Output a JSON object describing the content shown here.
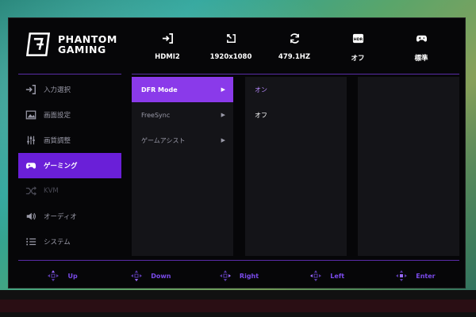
{
  "brand": {
    "line1": "PHANTOM",
    "line2": "GAMING"
  },
  "status": [
    {
      "icon": "input-icon",
      "value": "HDMI2"
    },
    {
      "icon": "resolution-icon",
      "value": "1920x1080"
    },
    {
      "icon": "refresh-icon",
      "value": "479.1HZ"
    },
    {
      "icon": "hdr-icon",
      "value": "オフ",
      "badge": "HDR"
    },
    {
      "icon": "gamepad-icon",
      "value": "標準"
    }
  ],
  "sidebar": [
    {
      "label": "入力選択",
      "icon": "input-icon"
    },
    {
      "label": "画面設定",
      "icon": "image-icon"
    },
    {
      "label": "画質調整",
      "icon": "sliders-icon"
    },
    {
      "label": "ゲーミング",
      "icon": "gamepad-icon",
      "active": true
    },
    {
      "label": "KVM",
      "icon": "kvm-icon",
      "disabled": true
    },
    {
      "label": "オーディオ",
      "icon": "speaker-icon"
    },
    {
      "label": "システム",
      "icon": "list-icon"
    }
  ],
  "submenu": [
    {
      "label": "DFR Mode",
      "active": true
    },
    {
      "label": "FreeSync"
    },
    {
      "label": "ゲームアシスト"
    }
  ],
  "values": [
    {
      "label": "オン",
      "selected": true
    },
    {
      "label": "オフ"
    }
  ],
  "footer": [
    "Up",
    "Down",
    "Right",
    "Left",
    "Enter"
  ],
  "colors": {
    "accent": "#6a1fd8",
    "highlight": "#8a3aea",
    "footer_text": "#7a4aea"
  }
}
